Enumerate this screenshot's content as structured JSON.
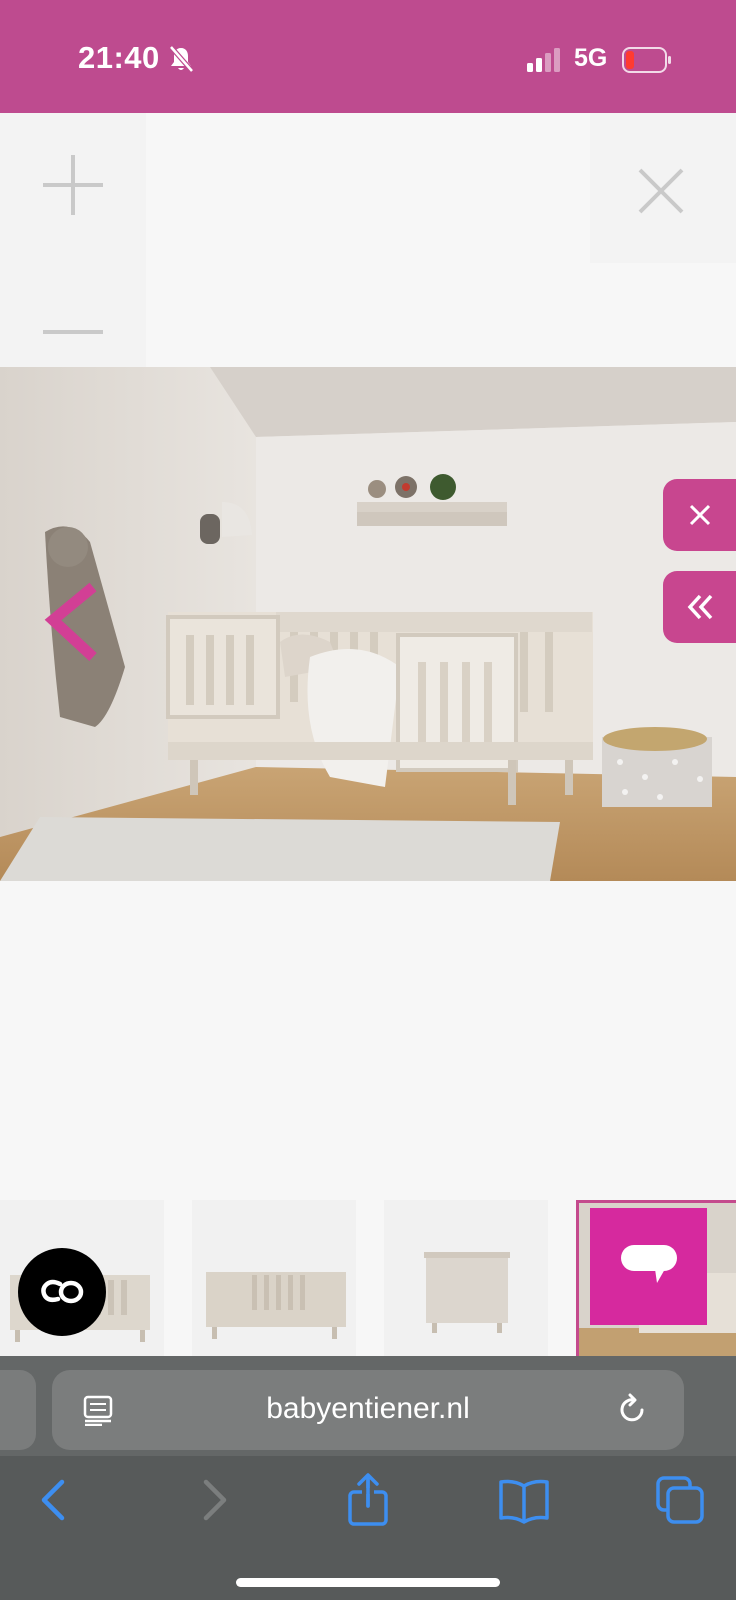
{
  "status_bar": {
    "time": "21:40",
    "network": "5G"
  },
  "colors": {
    "status_bar_bg": "#be4b8f",
    "accent_pink": "#c8468f",
    "chat_pink": "#d6299e",
    "browser_bg": "#575a5a",
    "browser_blue": "#3d8ef0"
  },
  "gallery": {
    "zoom_in_icon": "plus-icon",
    "zoom_out_icon": "minus-icon",
    "close_icon": "close-icon",
    "prev_icon": "chevron-left-icon",
    "side_close_icon": "close-icon",
    "side_collapse_icon": "double-chevron-left-icon",
    "thumbnail_count": 4,
    "active_thumbnail": 4
  },
  "widgets": {
    "co_button_icon": "co-logo-icon",
    "chat_button_icon": "chat-bubble-icon"
  },
  "browser": {
    "url": "babyentiener.nl",
    "nav_icons": [
      "back-icon",
      "forward-icon",
      "share-icon",
      "bookmarks-icon",
      "tabs-icon"
    ]
  }
}
